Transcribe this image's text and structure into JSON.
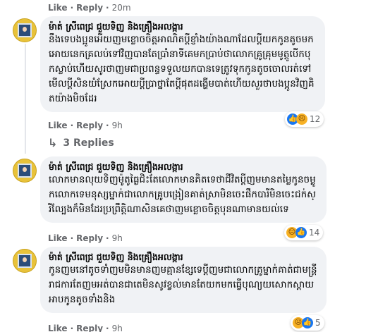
{
  "top_actions": {
    "like": "Like",
    "reply": "Reply",
    "time": "20m"
  },
  "comments": [
    {
      "author": "ម៉ាត់ ស្រីពេជ្រ ជួយទិញ និងគ្រឿងអលង្ការ",
      "text": "នឹងទេបងប្អូនអើយញមខ្លោចចិត្តអាណិតប្តីខ្ញាំងយ៉ាងណាដែលប្តីយកកូនតូចមកអោយនេកគ្រលប់ទៅវិញបានតែប្រាំនាទីគេមកប្រាប់ថាលោកគ្រូគ្រុមមូត្តូបើកបុកស្លាប់ហើយសូរថាញមជាប្រពន្ធទទួលយកបានទេត្រូវទុកកូនតូចចោលរត់ទៅមើលប្តីសិនយំស្រែកអោយប្តីប្រាថ្នាតែប្តីផុតដង្ហើមបាត់ហើយសួរថាបងប្អូនវិញគិតយ៉ាងមិចដែរ",
      "like": "Like",
      "reply": "Reply",
      "time": "9h",
      "reactions": {
        "icons": [
          "like-icon",
          "sad-icon"
        ],
        "count": "12"
      }
    },
    {
      "author": "ម៉ាត់ ស្រីពេជ្រ ជួយទិញ និងគ្រឿងអលង្ការ",
      "text": "លោកមានលុយទិញម៉ូតូធ្ងៃជិះតែលោកមានគិតទេថាជីវិតប្តីញមមានតម្លៃកូនចម្លូកលោកទេមនុស្សម្នាក់ជាលោកគ្រូបង្រៀនគាត់ស្រាមិនចេះផឹកបារីមិនចេះជក់ស្រីល្បែងក៏មិនដែរប្រព្រឹត្តិណាសិនគេថាញមខ្លោចចិត្តបុនណាមានយល់ទេ",
      "like": "Like",
      "reply": "Reply",
      "time": "9h",
      "reactions": {
        "icons": [
          "sad-icon",
          "like-icon"
        ],
        "count": "14"
      }
    },
    {
      "author": "ម៉ាត់ ស្រីពេជ្រ ជួយទិញ និងគ្រឿងអលង្ការ",
      "text": "កូនញមនៅតូចទាំញមមិនមានញមគ្មានខ្សែទេប្តីញមជាលោកគ្រូម្នាក់គាត់ជាមន្ត្រីរាជការតែញមអត់បានជាតេមិនសូវខ្វល់មានតែយកមកធ្វើបុណ្យយសោកស្តាយអាបកូនតូចទាំងនិង",
      "like": "Like",
      "reply": "Reply",
      "time": "9h",
      "reactions": {
        "icons": [
          "sad-icon",
          "like-icon"
        ],
        "count": "5"
      }
    }
  ],
  "replies_toggle": {
    "label": "3 Replies"
  }
}
